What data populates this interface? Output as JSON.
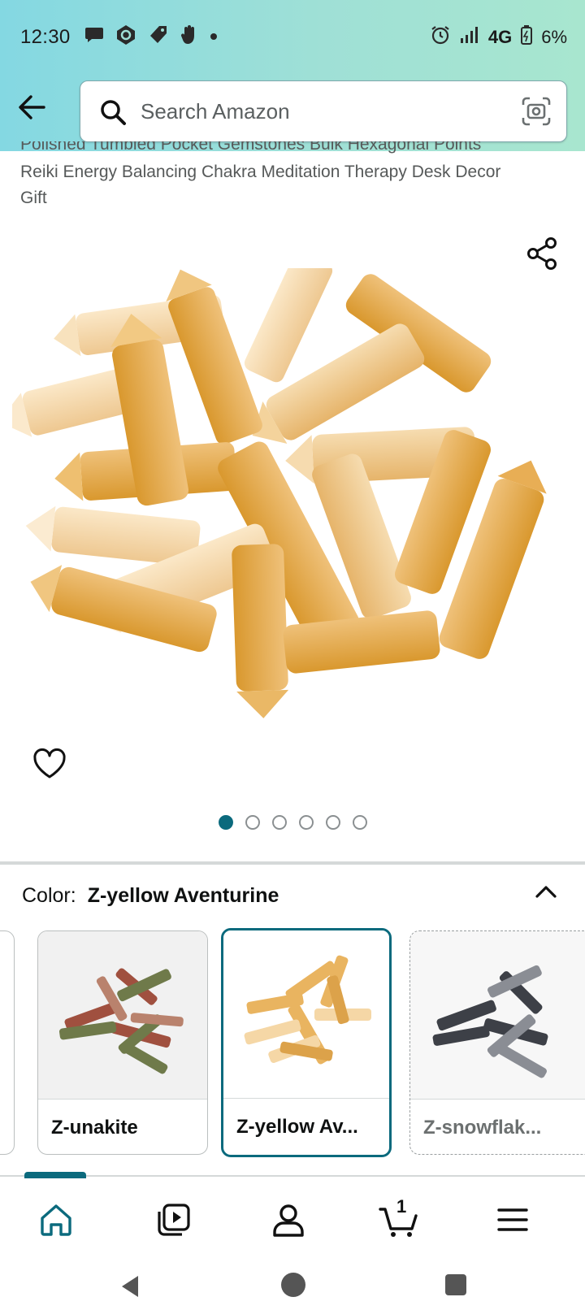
{
  "status_bar": {
    "time": "12:30",
    "network": "4G",
    "battery": "6%",
    "left_icons": [
      "chat-bubble-icon",
      "camera-app-icon",
      "tag-icon",
      "hand-wave-icon",
      "dot-icon"
    ],
    "right_icons": [
      "alarm-icon",
      "signal-icon",
      "battery-icon"
    ]
  },
  "header": {
    "search_placeholder": "Search Amazon",
    "back_icon": "arrow-left-icon",
    "camera_icon": "camera-scan-icon"
  },
  "product": {
    "title_line1": "Polished Tumbled Pocket Gemstones Bulk Hexagonal Points",
    "title_line2": "Reiki Energy Balancing Chakra Meditation Therapy Desk Decor",
    "title_line3": "Gift",
    "image_count": 6,
    "active_image_index": 0
  },
  "variation": {
    "color_label": "Color:",
    "color_value": "Z-yellow Aventurine",
    "swatches": [
      {
        "name": "Z-unakite",
        "state": "available"
      },
      {
        "name": "Z-yellow Av...",
        "state": "selected"
      },
      {
        "name": "Z-snowflak...",
        "state": "unavailable"
      }
    ]
  },
  "bottom_nav": {
    "items": [
      "home-icon",
      "video-icon",
      "account-icon",
      "cart-icon",
      "menu-icon"
    ],
    "cart_count": "1"
  },
  "colors": {
    "accent": "#0b6a7d",
    "header_start": "#84d8e2",
    "header_end": "#a8e6cf"
  }
}
